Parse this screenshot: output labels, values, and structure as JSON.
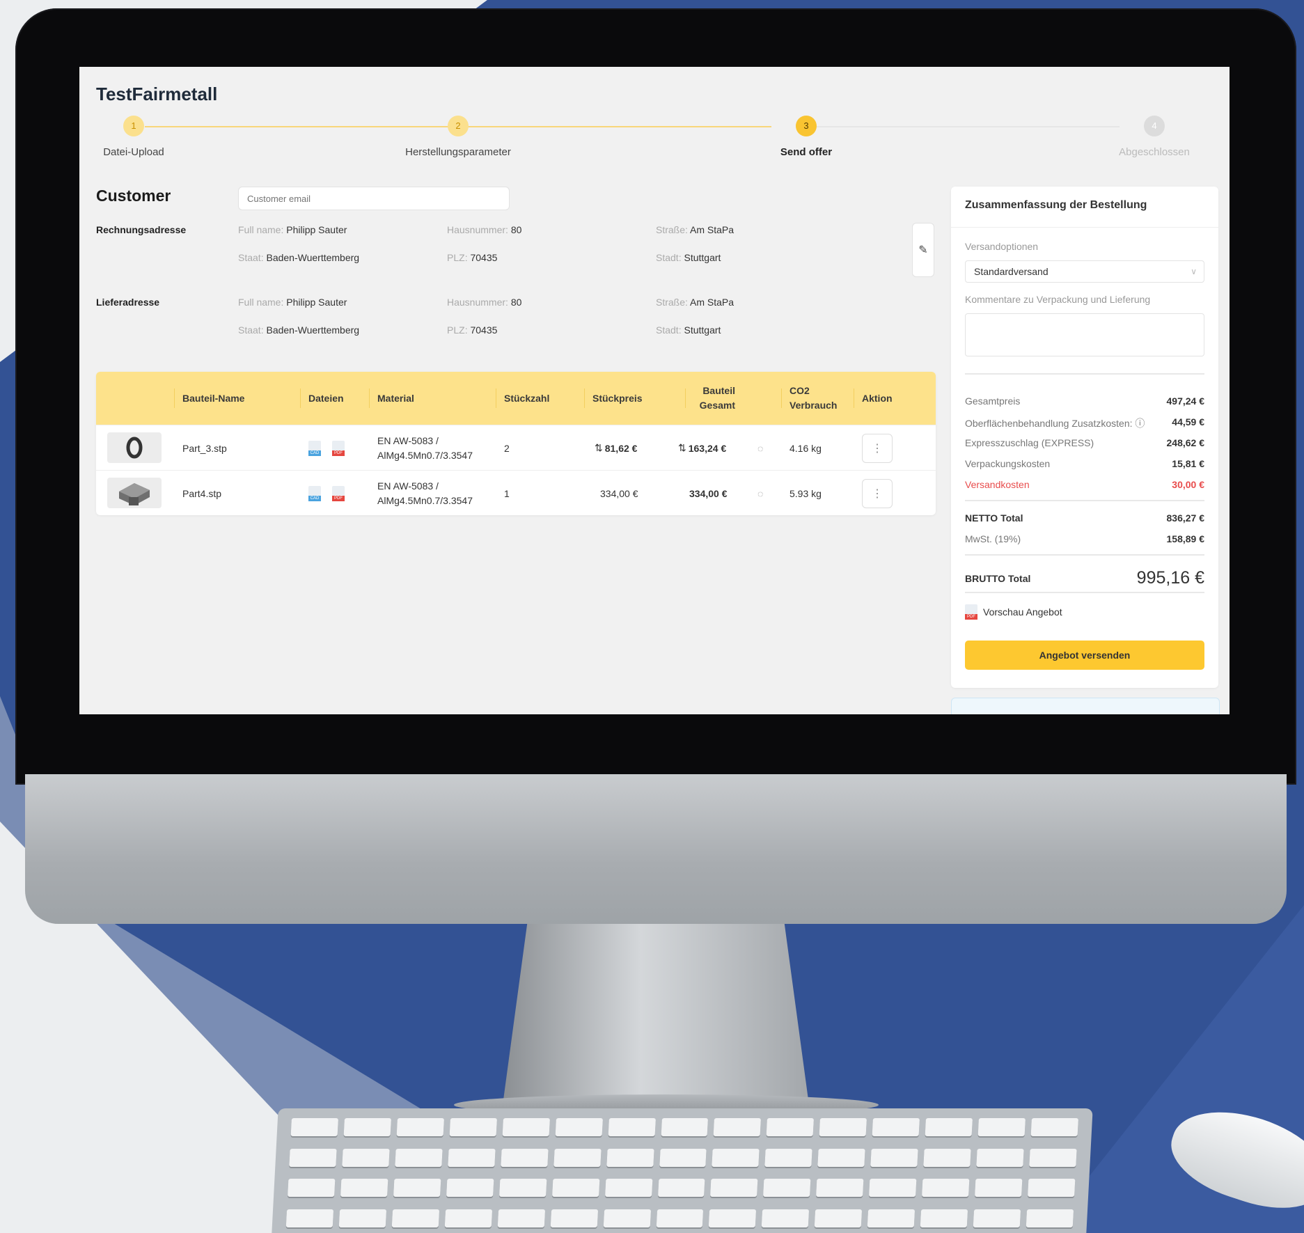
{
  "app": {
    "title": "TestFairmetall"
  },
  "steps": [
    {
      "num": "1",
      "label": "Datei-Upload"
    },
    {
      "num": "2",
      "label": "Herstellungsparameter"
    },
    {
      "num": "3",
      "label": "Send offer"
    },
    {
      "num": "4",
      "label": "Abgeschlossen"
    }
  ],
  "customer": {
    "heading": "Customer",
    "email_placeholder": "Customer email",
    "billing": {
      "label": "Rechnungsadresse",
      "full_name_key": "Full name",
      "full_name": "Philipp Sauter",
      "hausnummer_key": "Hausnummer",
      "hausnummer": "80",
      "strasse_key": "Straße",
      "strasse": "Am StaPa",
      "staat_key": "Staat",
      "staat": "Baden-Wuerttemberg",
      "plz_key": "PLZ",
      "plz": "70435",
      "stadt_key": "Stadt",
      "stadt": "Stuttgart"
    },
    "shipping": {
      "label": "Lieferadresse",
      "full_name_key": "Full name",
      "full_name": "Philipp Sauter",
      "hausnummer_key": "Hausnummer",
      "hausnummer": "80",
      "strasse_key": "Straße",
      "strasse": "Am StaPa",
      "staat_key": "Staat",
      "staat": "Baden-Wuerttemberg",
      "plz_key": "PLZ",
      "plz": "70435",
      "stadt_key": "Stadt",
      "stadt": "Stuttgart"
    }
  },
  "table": {
    "headers": {
      "name": "Bauteil-Name",
      "files": "Dateien",
      "material": "Material",
      "qty": "Stückzahl",
      "unit_price": "Stückpreis",
      "total_l1": "Bauteil",
      "total_l2": "Gesamt",
      "co2_l1": "CO2",
      "co2_l2": "Verbrauch",
      "action": "Aktion"
    },
    "rows": [
      {
        "name": "Part_3.stp",
        "file1": "CAD",
        "file2": "PDF",
        "material_l1": "EN AW-5083 /",
        "material_l2": "AlMg4.5Mn0.7/3.3547",
        "qty": "2",
        "unit_price": "81,62 €",
        "total": "163,24 €",
        "co2": "4.16 kg",
        "action": "⋮"
      },
      {
        "name": "Part4.stp",
        "file1": "CAD",
        "file2": "PDF",
        "material_l1": "EN AW-5083 /",
        "material_l2": "AlMg4.5Mn0.7/3.3547",
        "qty": "1",
        "unit_price": "334,00 €",
        "total": "334,00 €",
        "co2": "5.93 kg",
        "action": "⋮"
      }
    ]
  },
  "summary": {
    "title": "Zusammenfassung der Bestellung",
    "shipping_options_label": "Versandoptionen",
    "shipping_option_value": "Standardversand",
    "comment_label": "Kommentare zu Verpackung und Lieferung",
    "gesamtpreis_label": "Gesamtpreis",
    "gesamtpreis": "497,24 €",
    "surface_label": "Oberflächenbehandlung Zusatzkosten:",
    "surface": "44,59 €",
    "express_label": "Expresszuschlag (EXPRESS)",
    "express": "248,62 €",
    "packaging_label": "Verpackungskosten",
    "packaging": "15,81 €",
    "shipping_label": "Versandkosten",
    "shipping": "30,00 €",
    "netto_label": "NETTO Total",
    "netto": "836,27 €",
    "mwst_label": "MwSt. (19%)",
    "mwst": "158,89 €",
    "brutto_label": "BRUTTO Total",
    "brutto": "995,16 €",
    "preview_label": "Vorschau Angebot",
    "send_button": "Angebot versenden"
  },
  "colors": {
    "accent": "#fdc830",
    "table_header": "#fde28b",
    "warning_red": "#e84c4c",
    "background_blue": "#3b5ba0"
  }
}
